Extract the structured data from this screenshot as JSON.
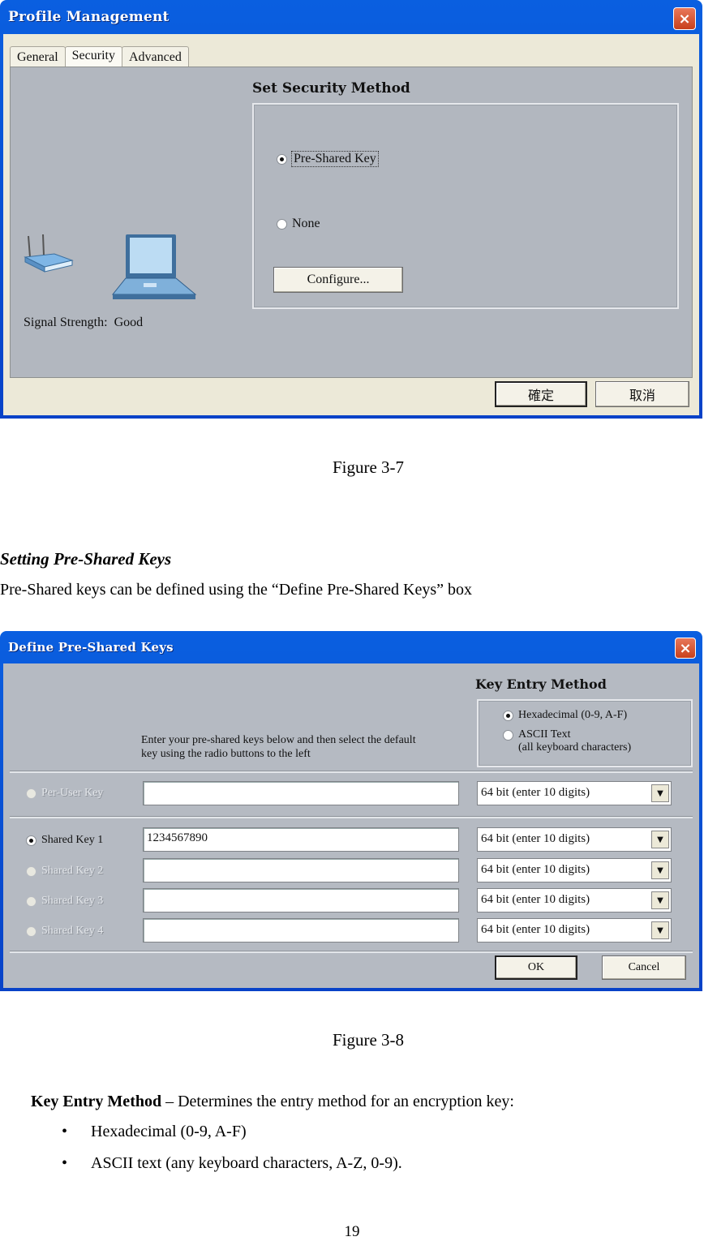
{
  "figure1": {
    "window_title": "Profile Management",
    "tabs": [
      {
        "label": "General",
        "active": false
      },
      {
        "label": "Security",
        "active": true
      },
      {
        "label": "Advanced",
        "active": false
      }
    ],
    "group_title": "Set Security Method",
    "options": [
      {
        "label": "Pre-Shared Key",
        "selected": true
      },
      {
        "label": "None",
        "selected": false
      }
    ],
    "configure_label": "Configure...",
    "signal_label": "Signal Strength:",
    "signal_value": "Good",
    "ok_label": "確定",
    "cancel_label": "取消",
    "close_icon": "×",
    "router_icon": "router-icon",
    "laptop_icon": "laptop-icon"
  },
  "caption1": "Figure 3-7",
  "section_heading": "Setting Pre-Shared Keys",
  "section_intro": "Pre-Shared keys can be defined using the “Define Pre-Shared Keys” box",
  "figure2": {
    "window_title": "Define Pre-Shared Keys",
    "close_icon": "×",
    "key_entry_title": "Key Entry Method",
    "entry_options": [
      {
        "label": "Hexadecimal (0-9, A-F)",
        "selected": true
      },
      {
        "label": "ASCII Text",
        "sublabel": "(all keyboard characters)",
        "selected": false
      }
    ],
    "instructions_line1": "Enter your pre-shared keys below and then select the default",
    "instructions_line2": "key using the radio buttons to the left",
    "unicast_key": {
      "label": "Per-User Key",
      "value": "",
      "size": "64 bit (enter 10 digits)",
      "enabled": false
    },
    "shared_keys": [
      {
        "label": "Shared Key 1",
        "value": "1234567890",
        "size": "64 bit (enter 10 digits)",
        "selected": true,
        "enabled": true
      },
      {
        "label": "Shared Key 2",
        "value": "",
        "size": "64 bit (enter 10 digits)",
        "selected": false,
        "enabled": false
      },
      {
        "label": "Shared Key 3",
        "value": "",
        "size": "64 bit (enter 10 digits)",
        "selected": false,
        "enabled": false
      },
      {
        "label": "Shared Key 4",
        "value": "",
        "size": "64 bit (enter 10 digits)",
        "selected": false,
        "enabled": false
      }
    ],
    "ok_label": "OK",
    "cancel_label": "Cancel",
    "dropdown_arrow": "▼"
  },
  "caption2": "Figure 3-8",
  "key_entry_desc": {
    "term": "Key Entry Method",
    "text": " – Determines the entry method for an encryption key:",
    "bullets": [
      "Hexadecimal (0-9, A-F)",
      "ASCII text (any keyboard characters, A-Z, 0-9)."
    ],
    "bullet_char": "•"
  },
  "page_number": "19"
}
